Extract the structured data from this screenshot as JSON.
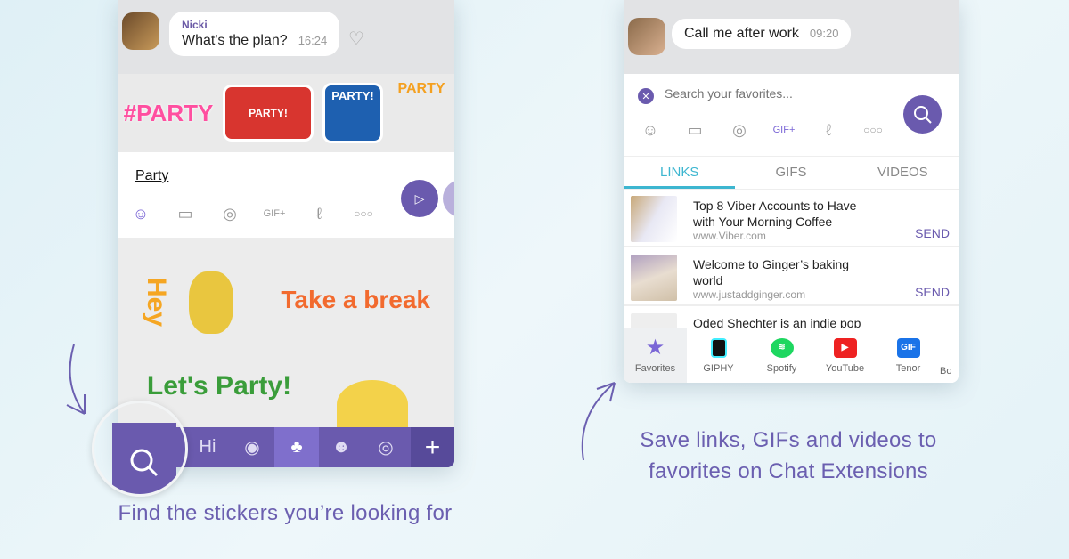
{
  "left_phone": {
    "message": {
      "sender": "Nicki",
      "text": "What's the plan?",
      "time": "16:24"
    },
    "sticker_suggestions": [
      "#PARTY",
      "PARTY!",
      "PARTY!",
      "PARTY"
    ],
    "input_value": "Party",
    "stickers": [
      "Hey",
      "Take a break",
      "Let's Party!",
      ""
    ],
    "tray_items": [
      "search",
      "Hi",
      "warriors",
      "pineapple",
      "girl",
      "donut"
    ]
  },
  "right_phone": {
    "message": {
      "text": "Call me after work",
      "time": "09:20"
    },
    "search_placeholder": "Search your favorites...",
    "tabs": [
      {
        "label": "LINKS",
        "active": true
      },
      {
        "label": "GIFS"
      },
      {
        "label": "VIDEOS"
      }
    ],
    "links": [
      {
        "title": "Top 8 Viber Accounts to Have with Your Morning Coffee",
        "url": "www.Viber.com",
        "action": "SEND"
      },
      {
        "title": "Welcome to Ginger’s baking world",
        "url": "www.justaddginger.com",
        "action": "SEND"
      },
      {
        "title": "Oded Shechter is an indie pop"
      }
    ],
    "extensions": [
      {
        "label": "Favorites",
        "active": true
      },
      {
        "label": "GIPHY"
      },
      {
        "label": "Spotify"
      },
      {
        "label": "YouTube"
      },
      {
        "label": "Tenor"
      },
      {
        "label": "Bo"
      }
    ]
  },
  "captions": {
    "left": "Find the stickers you’re looking for",
    "right_line1": "Save links, GIFs and videos to",
    "right_line2": "favorites on Chat Extensions"
  },
  "colors": {
    "accent": "#6a5aae",
    "tab_active": "#3db6d0",
    "caption": "#6b5fb0"
  }
}
